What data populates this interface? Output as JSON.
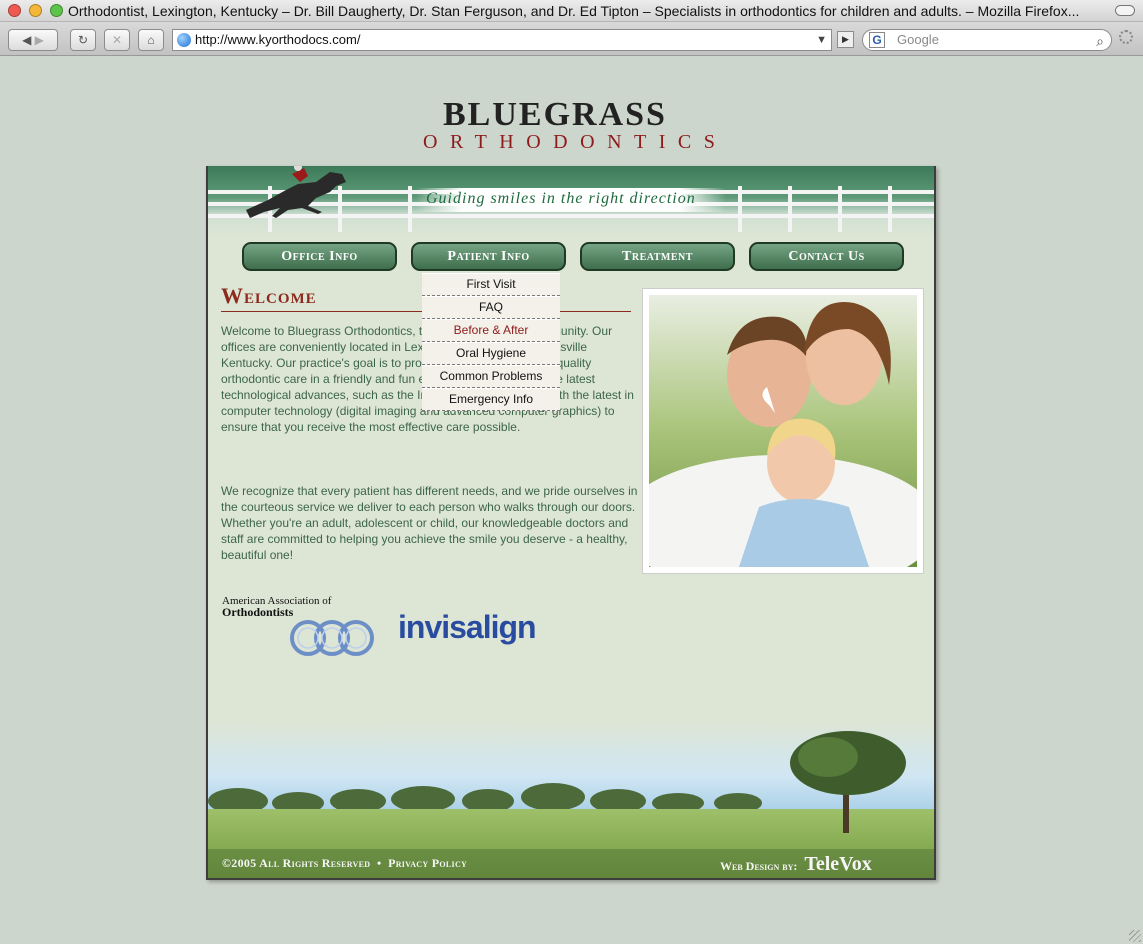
{
  "window": {
    "title": "Orthodontist, Lexington, Kentucky – Dr. Bill Daugherty, Dr. Stan Ferguson, and Dr. Ed Tipton – Specialists in orthodontics for children and adults. – Mozilla Firefox..."
  },
  "toolbar": {
    "url": "http://www.kyorthodocs.com/",
    "search_placeholder": "Google",
    "search_engine_letter": "G"
  },
  "logo": {
    "line1": "BLUEGRASS",
    "line2": "ORTHODONTICS"
  },
  "banner": {
    "tagline": "Guiding smiles in the right direction"
  },
  "nav": {
    "items": [
      {
        "label": "Office Info"
      },
      {
        "label": "Patient Info"
      },
      {
        "label": "Treatment"
      },
      {
        "label": "Contact Us"
      }
    ]
  },
  "dropdown": {
    "items": [
      {
        "label": "First Visit"
      },
      {
        "label": "FAQ"
      },
      {
        "label": "Before & After"
      },
      {
        "label": "Oral Hygiene"
      },
      {
        "label": "Common Problems"
      },
      {
        "label": "Emergency Info"
      }
    ]
  },
  "main": {
    "heading": "Welcome",
    "paragraph1": "Welcome to Bluegrass Orthodontics, the orthodontic care community. Our offices are conveniently located in Lexington, Paris, and Nicholasville Kentucky. Our practice's goal is to provide you with the highest quality orthodontic care in a friendly and fun environment.  We utilize the latest technological advances, such as the Invisalign system, along with the latest in computer technology (digital imaging and advanced computer graphics) to ensure that you receive the most effective care possible.",
    "paragraph2": "We recognize that every patient has different needs, and we pride ourselves in the courteous service we deliver to each person who walks through our doors. Whether you're an adult, adolescent or child, our knowledgeable doctors and staff are committed to helping you achieve the smile you deserve - a healthy, beautiful one!"
  },
  "logos": {
    "aao_line1": "American Association of",
    "aao_line2": "Orthodontists",
    "invisalign": "invisalign"
  },
  "footer": {
    "copyright": "©2005 All Rights Reserved",
    "separator": "•",
    "privacy": "Privacy Policy",
    "design_by": "Web Design by:",
    "designer": "TeleVox"
  }
}
